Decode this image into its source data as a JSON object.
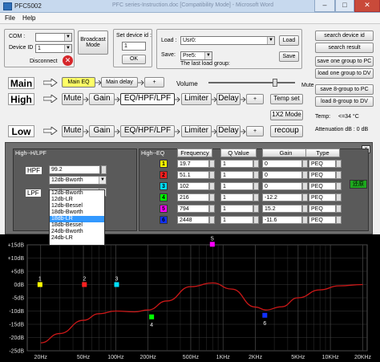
{
  "window": {
    "title": "PFC5002",
    "blurred_title": "PFC series-Instruction.doc [Compatibility Mode] - Microsoft Word",
    "min": "–",
    "max": "□",
    "close": "✕"
  },
  "menu": [
    "File",
    "Help"
  ],
  "connection": {
    "com_label": "COM :",
    "com_value": "",
    "device_id_label": "Device ID :",
    "device_id_value": "1",
    "disconnect_label": "Disconnect",
    "broadcast_label": "Broadcast Mode"
  },
  "device_id_set": {
    "label": "Set device id :",
    "value": "1",
    "ok_label": "OK"
  },
  "load_save": {
    "load_label": "Load :",
    "load_value": "Usr0:",
    "load_button": "Load",
    "save_label": "Save:",
    "save_value": "Pre5:",
    "save_button": "Save",
    "last_load_label": "The last load group:"
  },
  "right_buttons": [
    "search device id",
    "search result",
    "save one group to PC",
    "load one group to DV",
    "save 8-group to PC",
    "load 8-group to DV"
  ],
  "temp": {
    "label": "Temp:",
    "value": "<=34 °C"
  },
  "attenuation": {
    "label": "Attenuation dB : 0 dB"
  },
  "main_row": {
    "label": "Main",
    "main_eq": "Main EQ",
    "main_delay": "Main delay",
    "plus": "+",
    "volume_label": "Volume",
    "mute_label": "Mute",
    "volume_level": 0.78
  },
  "high_row": {
    "label": "High",
    "mute": "Mute",
    "gain": "Gain",
    "eq": "EQ/HPF/LPF",
    "limiter": "Limiter",
    "delay": "Delay",
    "plus": "+",
    "temp_set": "Temp set"
  },
  "mode_button": "1X2 Mode",
  "low_row": {
    "label": "Low",
    "mute": "Mute",
    "gain": "Gain",
    "eq": "EQ/HPF/LPF",
    "limiter": "Limiter",
    "delay": "Delay",
    "plus": "+",
    "recoup": "recoup"
  },
  "hlpf": {
    "title": "High--H/LPF",
    "hpf_label": "HPF",
    "hpf_value": "99.2",
    "hpf_type": "12db-Bworth",
    "lpf_label": "LPF",
    "lpf_type": "12db-Bworth",
    "options": [
      "12db-Bworth",
      "12db-LR",
      "12db-Bessel",
      "18db-Bworth",
      "18db-LR",
      "18db-Bessel",
      "24db-Bworth",
      "24db-LR"
    ],
    "selected_option": "18db-LR"
  },
  "eq": {
    "title": "High--EQ",
    "headers": [
      "Frequency",
      "Q Value",
      "Gain",
      "Type"
    ],
    "bands": [
      {
        "num": "1",
        "color": "#ffff00",
        "freq": "19.7",
        "q": "1",
        "gain": "0",
        "type": "PEQ"
      },
      {
        "num": "2",
        "color": "#ff2020",
        "freq": "51.1",
        "q": "1",
        "gain": "0",
        "type": "PEQ"
      },
      {
        "num": "3",
        "color": "#00e0ff",
        "freq": "102",
        "q": "1",
        "gain": "0",
        "type": "PEQ"
      },
      {
        "num": "4",
        "color": "#00ff00",
        "freq": "216",
        "q": "1",
        "gain": "-12.2",
        "type": "PEQ"
      },
      {
        "num": "5",
        "color": "#ff00ff",
        "freq": "794",
        "q": "1",
        "gain": "15.2",
        "type": "PEQ"
      },
      {
        "num": "6",
        "color": "#1030ff",
        "freq": "2448",
        "q": "1",
        "gain": "-11.6",
        "type": "PEQ"
      }
    ],
    "reset_label": "还原",
    "close": "x"
  },
  "chart_data": {
    "type": "line",
    "xscale": "log",
    "xlim": [
      15,
      22000
    ],
    "ylim": [
      -25,
      15
    ],
    "y_ticks": [
      15,
      10,
      5,
      0,
      -5,
      -10,
      -15,
      -20,
      -25
    ],
    "y_tick_labels": [
      "+15dB",
      "+10dB",
      "+5dB",
      "0dB",
      "-5dB",
      "-10dB",
      "-15dB",
      "-20dB",
      "-25dB"
    ],
    "x_ticks": [
      20,
      50,
      100,
      200,
      500,
      1000,
      2000,
      5000,
      10000,
      20000
    ],
    "x_tick_labels": [
      "20Hz",
      "50Hz",
      "100Hz",
      "200Hz",
      "500Hz",
      "1KHz",
      "2KHz",
      "5KHz",
      "10KHz",
      "20KHz"
    ],
    "grid": true,
    "curve": {
      "color": "#cc1818",
      "x": [
        20,
        30,
        50,
        70,
        100,
        150,
        200,
        300,
        500,
        800,
        1200,
        2000,
        2500,
        3500,
        5000,
        8000,
        12000,
        20000
      ],
      "y": [
        -22,
        -18.5,
        -13.5,
        -11,
        -10,
        -10.3,
        -9.6,
        -6.2,
        -0.8,
        0.6,
        -1.7,
        -8.5,
        -9.6,
        -8.4,
        -5,
        -2,
        -0.5,
        0
      ]
    },
    "points": [
      {
        "label": "1",
        "freq": 19.7,
        "gain": 0,
        "color": "#ffff00"
      },
      {
        "label": "2",
        "freq": 51.1,
        "gain": 0,
        "color": "#ff2020"
      },
      {
        "label": "3",
        "freq": 102,
        "gain": 0,
        "color": "#00e0ff"
      },
      {
        "label": "4",
        "freq": 216,
        "gain": -12.2,
        "color": "#00ff00"
      },
      {
        "label": "5",
        "freq": 794,
        "gain": 15.2,
        "color": "#ff00ff"
      },
      {
        "label": "6",
        "freq": 2448,
        "gain": -11.6,
        "color": "#1030ff"
      }
    ]
  }
}
